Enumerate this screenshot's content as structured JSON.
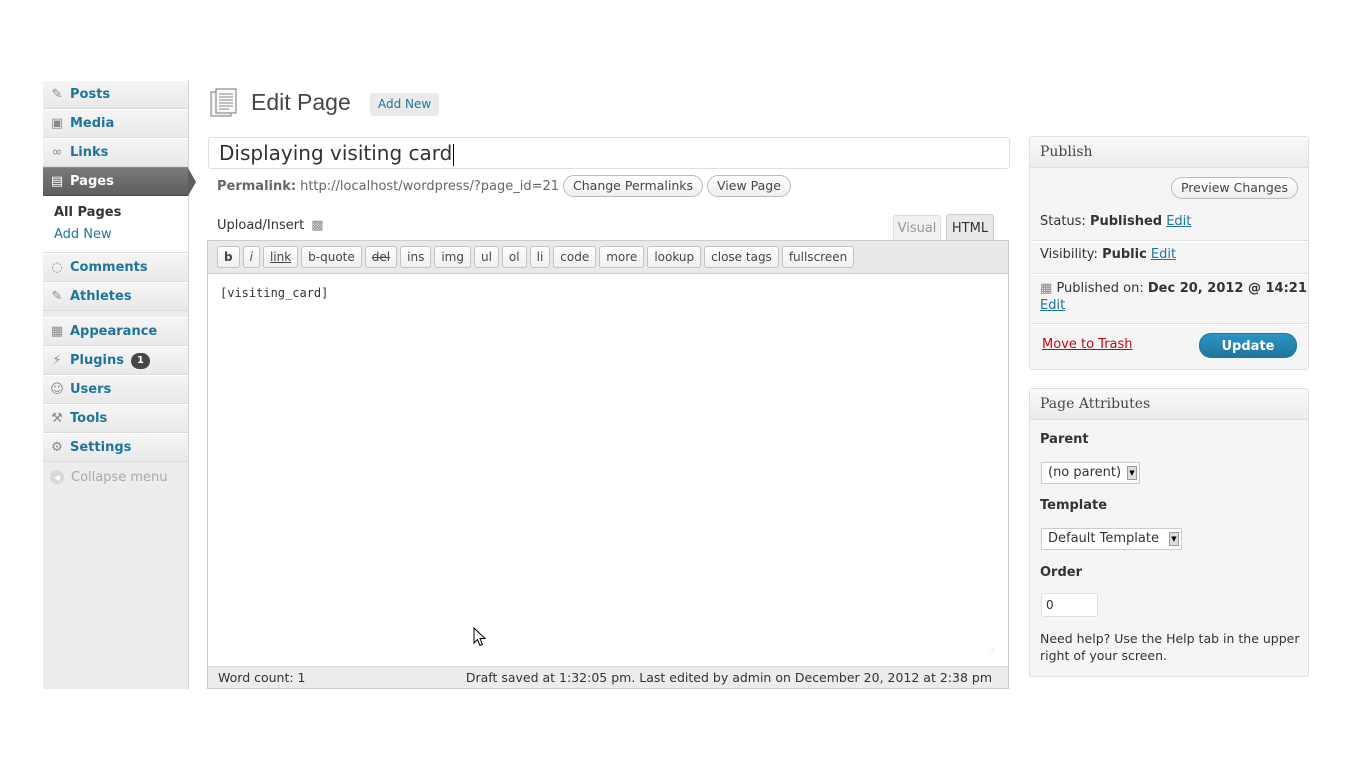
{
  "sidebar": {
    "items": [
      {
        "label": "Posts",
        "icon": "pin-icon"
      },
      {
        "label": "Media",
        "icon": "media-icon"
      },
      {
        "label": "Links",
        "icon": "link-icon"
      },
      {
        "label": "Pages",
        "icon": "pages-icon"
      },
      {
        "label": "Comments",
        "icon": "comments-icon"
      },
      {
        "label": "Athletes",
        "icon": "pin-icon"
      },
      {
        "label": "Appearance",
        "icon": "appearance-icon"
      },
      {
        "label": "Plugins",
        "icon": "plugins-icon",
        "badge": "1"
      },
      {
        "label": "Users",
        "icon": "users-icon"
      },
      {
        "label": "Tools",
        "icon": "tools-icon"
      },
      {
        "label": "Settings",
        "icon": "settings-icon"
      }
    ],
    "submenu": {
      "all_pages": "All Pages",
      "add_new": "Add New"
    },
    "collapse_label": "Collapse menu"
  },
  "header": {
    "title": "Edit Page",
    "add_new": "Add New"
  },
  "editor": {
    "title_value": "Displaying visiting card",
    "permalink_label": "Permalink:",
    "permalink_url": "http://localhost/wordpress/?page_id=21",
    "change_permalinks": "Change Permalinks",
    "view_page": "View Page",
    "upload_insert": "Upload/Insert",
    "tabs": {
      "visual": "Visual",
      "html": "HTML"
    },
    "quicktags": [
      "b",
      "i",
      "link",
      "b-quote",
      "del",
      "ins",
      "img",
      "ul",
      "ol",
      "li",
      "code",
      "more",
      "lookup",
      "close tags",
      "fullscreen"
    ],
    "content": "[visiting_card]",
    "word_count": "Word count: 1",
    "draft_status": "Draft saved at 1:32:05 pm. Last edited by admin on December 20, 2012 at 2:38 pm"
  },
  "publish": {
    "title": "Publish",
    "preview_changes": "Preview Changes",
    "status_label": "Status:",
    "status_value": "Published",
    "visibility_label": "Visibility:",
    "visibility_value": "Public",
    "edit": "Edit",
    "published_on_label": "Published on:",
    "published_on_value": "Dec 20, 2012 @ 14:21",
    "move_to_trash": "Move to Trash",
    "update": "Update"
  },
  "page_attributes": {
    "title": "Page Attributes",
    "parent_label": "Parent",
    "parent_value": "(no parent)",
    "template_label": "Template",
    "template_value": "Default Template",
    "order_label": "Order",
    "order_value": "0",
    "help_text": "Need help? Use the Help tab in the upper right of your screen."
  },
  "colors": {
    "link": "#21759b",
    "update_button": "#21759b",
    "trash": "#bc0b0b",
    "current_menu": "#6d6d6d"
  }
}
